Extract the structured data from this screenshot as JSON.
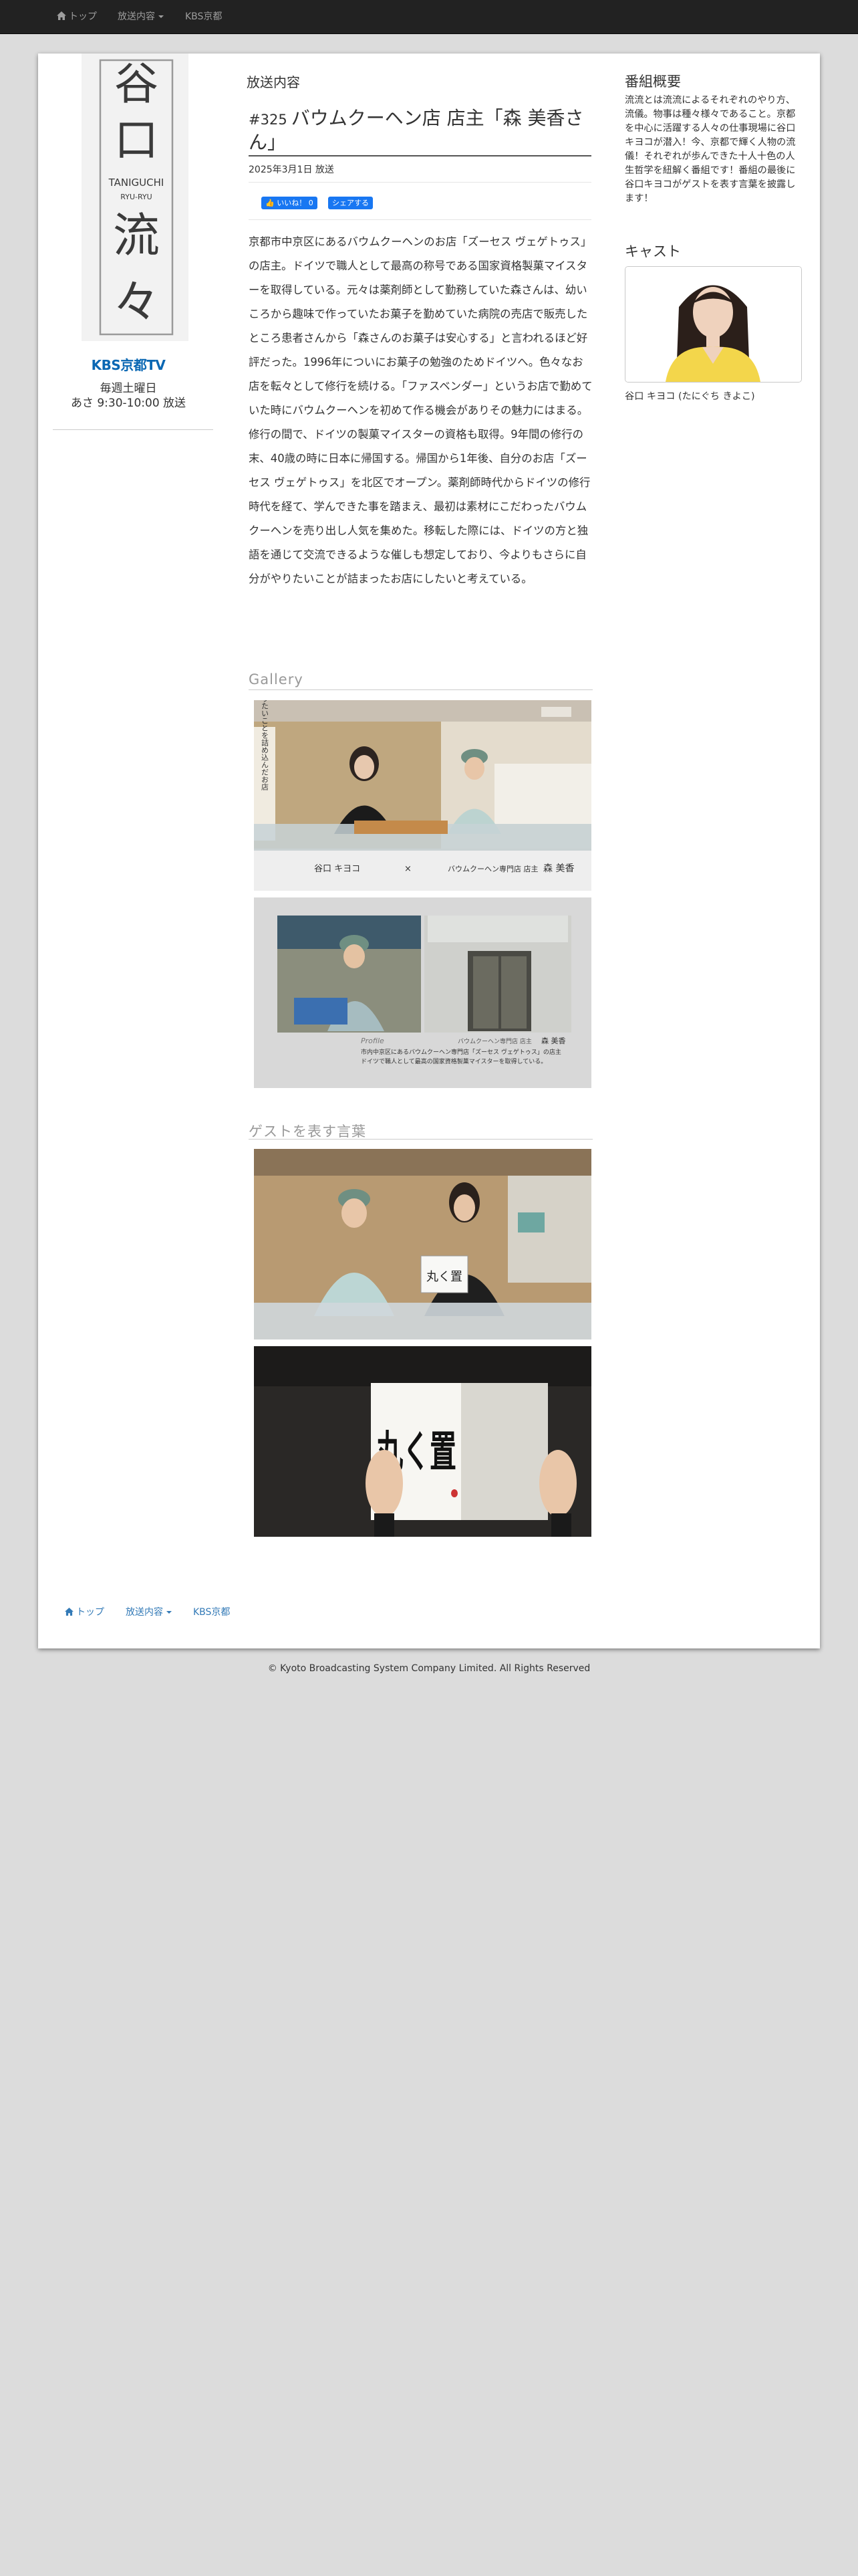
{
  "navbar": {
    "items": [
      {
        "label": "トップ"
      },
      {
        "label": "放送内容"
      },
      {
        "label": "KBS京都"
      }
    ]
  },
  "left": {
    "logo_kanji": [
      "谷",
      "口",
      "流",
      "々"
    ],
    "logo_romaji": "TANIGUCHI",
    "logo_romaji2": "RYU-RYU",
    "station_logo": "KBS京都TV",
    "schedule_day": "毎週土曜日",
    "schedule_time": "あさ 9:30-10:00 放送"
  },
  "main": {
    "section_heading": "放送内容",
    "episode_number": "#325",
    "episode_title": "バウムクーヘン店 店主「森 美香さん」",
    "air_date": "2025年3月1日 放送",
    "like_label": "いいね！ 0",
    "share_label": "シェアする",
    "body": "京都市中京区にあるバウムクーヘンのお店「ズーセス ヴェゲトゥス」の店主。ドイツで職人として最高の称号である国家資格製菓マイスターを取得している。元々は薬剤師として勤務していた森さんは、幼いころから趣味で作っていたお菓子を勤めていた病院の売店で販売したところ患者さんから「森さんのお菓子は安心する」と言われるほど好評だった。1996年についにお菓子の勉強のためドイツへ。色々なお店を転々として修行を続ける。「ファスベンダー」というお店で勤めていた時にバウムクーヘンを初めて作る機会がありその魅力にはまる。修行の間で、ドイツの製菓マイスターの資格も取得。9年間の修行の末、40歳の時に日本に帰国する。帰国から1年後、自分のお店「ズーセス ヴェゲトゥス」を北区でオープン。薬剤師時代からドイツの修行時代を経て、学んできた事を踏まえ、最初は素材にこだわったバウムクーヘンを売り出し人気を集めた。移転した際には、ドイツの方と独語を通じて交流できるような催しも想定しており、今よりもさらに自分がやりたいことが詰まったお店にしたいと考えている。",
    "gallery_heading": "Gallery",
    "gallery_photo1": {
      "vertical_caption": "やりたいことを詰め込んだお店",
      "lower_left": "谷口 キヨコ",
      "cross": "×",
      "lower_mid": "バウムクーヘン専門店 店主",
      "lower_right": "森 美香"
    },
    "gallery_photo2": {
      "profile_label": "Profile",
      "profile_shop": "バウムクーヘン専門店 店主",
      "profile_name": "森 美香",
      "profile_line1": "市内中京区にあるバウムクーヘン専門店「ズーセス ヴェゲトゥス」の店主",
      "profile_line2": "ドイツで職人として最高の国家資格製菓マイスターを取得している。"
    },
    "words_heading": "ゲストを表す言葉",
    "calligraphy_text": "丸く置",
    "calligraphy_small": "丸く置"
  },
  "sidebar": {
    "summary_heading": "番組概要",
    "summary_text": "流流とは流流によるそれぞれのやり方、流儀。物事は種々様々であること。京都を中心に活躍する人々の仕事現場に谷口キヨコが潜入！今、京都で輝く人物の流儀！それぞれが歩んできた十人十色の人生哲学を紐解く番組です！番組の最後に谷口キヨコがゲストを表す言葉を披露します！",
    "cast_heading": "キャスト",
    "cast_name": "谷口 キヨコ (たにぐち きよこ)"
  },
  "footer": {
    "nav": [
      {
        "label": "トップ"
      },
      {
        "label": "放送内容"
      },
      {
        "label": "KBS京都"
      }
    ],
    "copyright": "© Kyoto Broadcasting System Company Limited. All Rights Reserved"
  },
  "colors": {
    "navbar_bg": "#222222",
    "link_blue": "#337ab7",
    "facebook_blue": "#1877f2",
    "station_blue": "#0a67b3"
  }
}
